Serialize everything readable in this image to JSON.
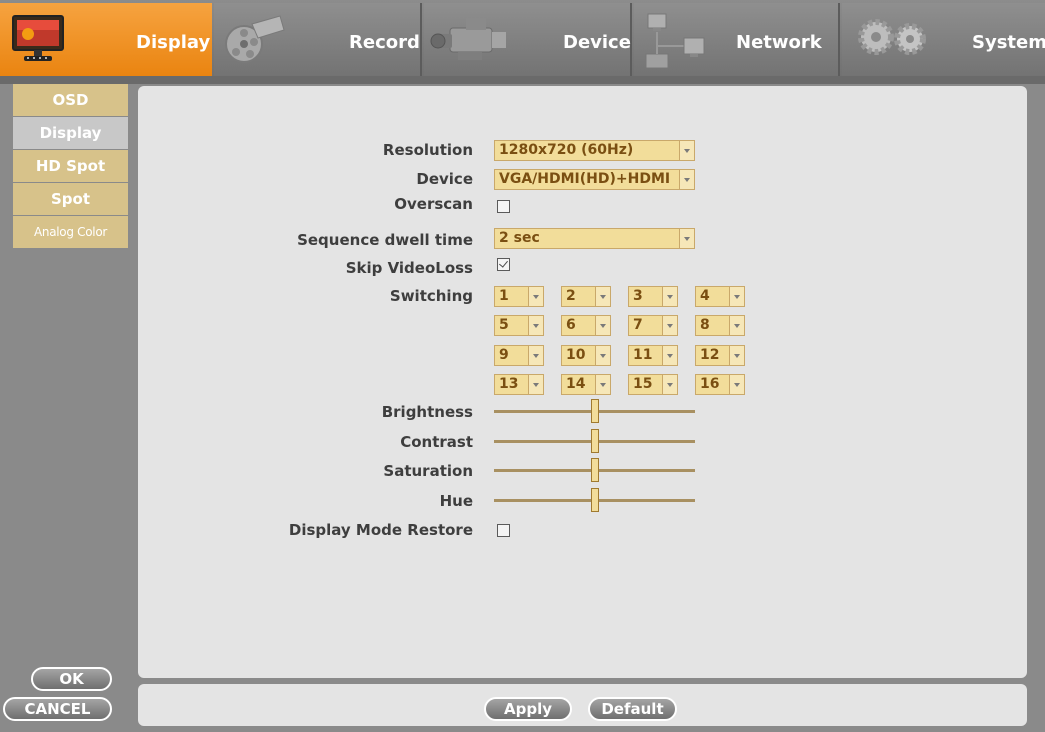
{
  "tabs": [
    {
      "label": "Display",
      "icon": "monitor-icon",
      "active": true
    },
    {
      "label": "Record",
      "icon": "film-reel-icon"
    },
    {
      "label": "Device",
      "icon": "camcorder-icon"
    },
    {
      "label": "Network",
      "icon": "network-computers-icon"
    },
    {
      "label": "System",
      "icon": "gears-icon"
    }
  ],
  "sidebar": {
    "items": [
      {
        "label": "OSD"
      },
      {
        "label": "Display",
        "active": true
      },
      {
        "label": "HD Spot"
      },
      {
        "label": "Spot"
      },
      {
        "label": "Analog Color"
      }
    ],
    "ok_label": "OK",
    "cancel_label": "CANCEL"
  },
  "form": {
    "resolution": {
      "label": "Resolution",
      "value": "1280x720 (60Hz)"
    },
    "device": {
      "label": "Device",
      "value": "VGA/HDMI(HD)+HDMI"
    },
    "overscan": {
      "label": "Overscan",
      "checked": false
    },
    "dwell": {
      "label": "Sequence dwell time",
      "value": "2 sec"
    },
    "skip_videoloss": {
      "label": "Skip VideoLoss",
      "checked": true
    },
    "switching": {
      "label": "Switching",
      "values": [
        "1",
        "2",
        "3",
        "4",
        "5",
        "6",
        "7",
        "8",
        "9",
        "10",
        "11",
        "12",
        "13",
        "14",
        "15",
        "16"
      ]
    },
    "brightness": {
      "label": "Brightness",
      "level": 0.5
    },
    "contrast": {
      "label": "Contrast",
      "level": 0.5
    },
    "saturation": {
      "label": "Saturation",
      "level": 0.5
    },
    "hue": {
      "label": "Hue",
      "level": 0.5
    },
    "display_mode_restore": {
      "label": "Display Mode Restore",
      "checked": false
    }
  },
  "footer": {
    "apply_label": "Apply",
    "default_label": "Default"
  },
  "colors": {
    "active_tab": "#f39a2f",
    "field_bg": "#f2dd9a",
    "sidebar_item": "#d7c28a"
  }
}
